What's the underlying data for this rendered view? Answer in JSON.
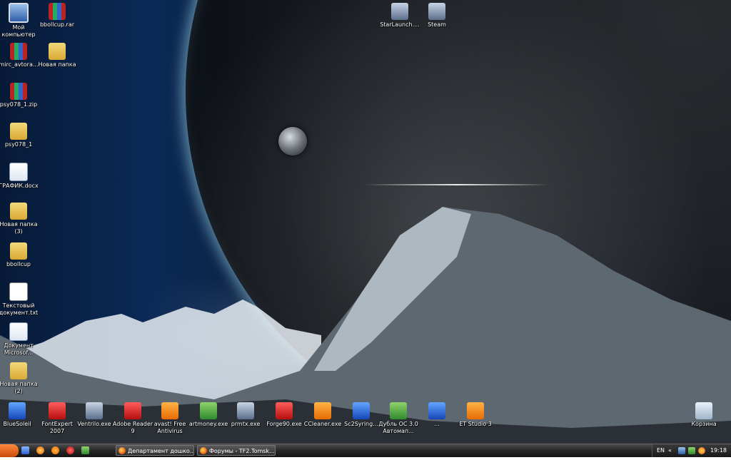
{
  "desktop": {
    "left_icons": [
      {
        "label": "Мой компьютер",
        "icon": "my-computer-icon",
        "kind": "pc"
      },
      {
        "label": "bbollcup.rar",
        "icon": "rar-archive-icon",
        "kind": "rar"
      },
      {
        "label": "mirc_avtora...",
        "icon": "zip-archive-icon",
        "kind": "rar"
      },
      {
        "label": "Новая папка",
        "icon": "folder-icon",
        "kind": "folder"
      },
      {
        "label": "psy078_1.zip",
        "icon": "zip-archive-icon",
        "kind": "rar"
      },
      {
        "label": "psy078_1",
        "icon": "folder-icon",
        "kind": "folder"
      },
      {
        "label": "ГРАФИК.docx",
        "icon": "word-document-icon",
        "kind": "doc"
      },
      {
        "label": "Новая папка (3)",
        "icon": "folder-icon",
        "kind": "folder"
      },
      {
        "label": "bbollcup",
        "icon": "folder-icon",
        "kind": "folder"
      },
      {
        "label": "Текстовый документ.txt",
        "icon": "text-document-icon",
        "kind": "txt"
      },
      {
        "label": "Документ Microsof...",
        "icon": "word-document-icon",
        "kind": "doc"
      },
      {
        "label": "Новая папка (2)",
        "icon": "folder-icon",
        "kind": "folder"
      }
    ],
    "top_icons": [
      {
        "label": "StarLaunch....",
        "icon": "starcraft-launcher-icon"
      },
      {
        "label": "Steam",
        "icon": "steam-icon"
      }
    ],
    "bottom_icons": [
      {
        "label": "BlueSoleil",
        "icon": "bluetooth-icon",
        "kind": "blue"
      },
      {
        "label": "FontExpert 2007",
        "icon": "fontexpert-icon",
        "kind": "red"
      },
      {
        "label": "Ventrilo.exe",
        "icon": "ventrilo-icon",
        "kind": "app"
      },
      {
        "label": "Adobe Reader 9",
        "icon": "adobe-reader-icon",
        "kind": "red"
      },
      {
        "label": "avast! Free Antivirus",
        "icon": "avast-icon",
        "kind": "orange"
      },
      {
        "label": "artmoney.exe",
        "icon": "artmoney-icon",
        "kind": "green"
      },
      {
        "label": "prmtx.exe",
        "icon": "clock-app-icon",
        "kind": "app"
      },
      {
        "label": "Forge90.exe",
        "icon": "forge-icon",
        "kind": "red"
      },
      {
        "label": "CCleaner.exe",
        "icon": "ccleaner-icon",
        "kind": "orange"
      },
      {
        "label": "Sc2Syring...",
        "icon": "sc2-tool-icon",
        "kind": "blue"
      },
      {
        "label": "Дубль ОС 3.0 Автомап...",
        "icon": "dubl-os-icon",
        "kind": "green"
      },
      {
        "label": "...",
        "icon": "app-m-icon",
        "kind": "blue"
      },
      {
        "label": "ET Studio 3",
        "icon": "et-studio-icon",
        "kind": "orange"
      }
    ],
    "recycle_bin": {
      "label": "Корзина",
      "icon": "recycle-bin-icon"
    }
  },
  "taskbar": {
    "quick_launch": [
      "show-desktop-icon",
      "firefox-icon",
      "avast-quick-icon",
      "opera-icon",
      "green-app-icon"
    ],
    "buttons": [
      {
        "label": "Департамент дошко...",
        "icon": "firefox-icon"
      },
      {
        "label": "Форумы - TF2.Tomsk....",
        "icon": "firefox-icon"
      }
    ],
    "tray": {
      "lang": "EN",
      "chevron": "«",
      "clock": "19:18"
    }
  },
  "colors": {
    "taskbar": "#262626",
    "start": "#e8590c",
    "label_text": "#ffffff"
  }
}
